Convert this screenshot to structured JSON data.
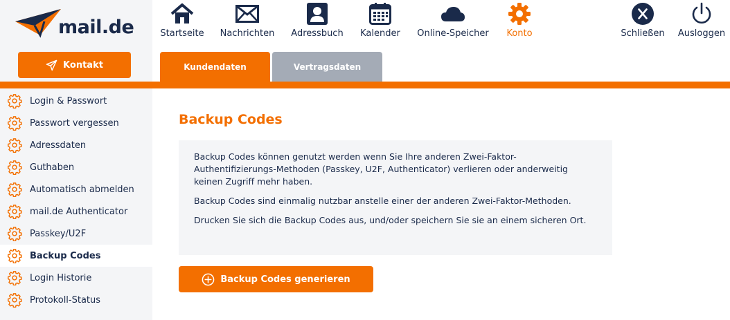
{
  "brand": {
    "name": "mail.de",
    "accent": "#f36f00",
    "dark": "#1a2a4a"
  },
  "contact_button": {
    "label": "Kontakt",
    "icon": "paper-plane-icon"
  },
  "top_nav": [
    {
      "label": "Startseite",
      "icon": "home-icon"
    },
    {
      "label": "Nachrichten",
      "icon": "envelope-icon"
    },
    {
      "label": "Adressbuch",
      "icon": "contact-card-icon"
    },
    {
      "label": "Kalender",
      "icon": "calendar-icon"
    },
    {
      "label": "Online-Speicher",
      "icon": "cloud-icon"
    },
    {
      "label": "Konto",
      "icon": "gear-icon",
      "active": true
    },
    {
      "label": "Schließen",
      "icon": "close-icon"
    },
    {
      "label": "Ausloggen",
      "icon": "power-icon"
    }
  ],
  "tabs": [
    {
      "label": "Kundendaten",
      "active": true
    },
    {
      "label": "Vertragsdaten",
      "active": false
    }
  ],
  "sidebar": {
    "items": [
      {
        "label": "Login & Passwort"
      },
      {
        "label": "Passwort vergessen"
      },
      {
        "label": "Adressdaten"
      },
      {
        "label": "Guthaben"
      },
      {
        "label": "Automatisch abmelden"
      },
      {
        "label": "mail.de Authenticator"
      },
      {
        "label": "Passkey/U2F"
      },
      {
        "label": "Backup Codes",
        "active": true
      },
      {
        "label": "Login Historie"
      },
      {
        "label": "Protokoll-Status"
      }
    ]
  },
  "main": {
    "title": "Backup Codes",
    "paragraphs": [
      "Backup Codes können genutzt werden wenn Sie Ihre anderen Zwei-Faktor-Authentifizierungs-Methoden (Passkey, U2F, Authenticator) verlieren oder anderweitig keinen Zugriff mehr haben.",
      "Backup Codes sind einmalig nutzbar anstelle einer der anderen Zwei-Faktor-Methoden.",
      "Drucken Sie sich die Backup Codes aus, und/oder speichern Sie sie an einem sicheren Ort."
    ],
    "generate_button": {
      "label": "Backup Codes generieren",
      "icon": "plus-circle-icon"
    }
  }
}
